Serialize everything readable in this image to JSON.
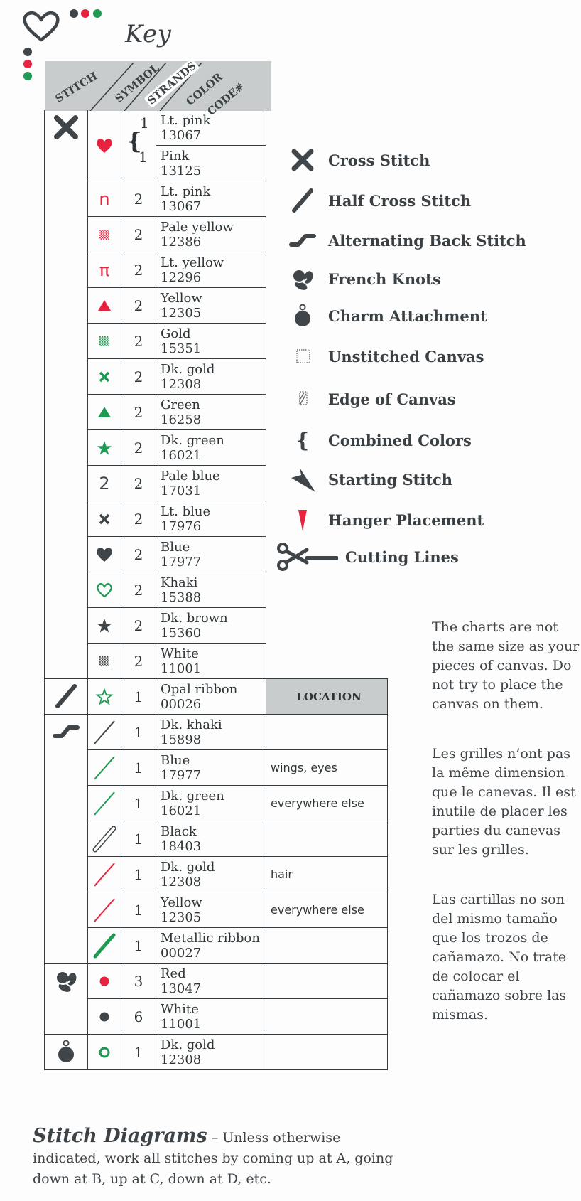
{
  "page": {
    "title": "Key",
    "decor_colors": {
      "dark": "#3f4548",
      "red": "#e8233f",
      "green": "#1e9a52"
    }
  },
  "key_table": {
    "headers": {
      "stitch": "STITCH",
      "symbol": "SYMBOL",
      "strands": "STRANDS",
      "color": "COLOR",
      "code": "CODE#",
      "location": "LOCATION"
    },
    "rows": [
      {
        "stitch": "cross-stitch",
        "symbol": "heart-filled",
        "symbol_color": "#e8233f",
        "strands": "1",
        "color": "Lt. pink",
        "code": "13067",
        "combined": true
      },
      {
        "stitch": "",
        "symbol": "",
        "symbol_color": "",
        "strands": "1",
        "color": "Pink",
        "code": "13125",
        "combined": true
      },
      {
        "stitch": "",
        "symbol": "n",
        "symbol_color": "#e8233f",
        "strands": "2",
        "color": "Lt. pink",
        "code": "13067"
      },
      {
        "stitch": "",
        "symbol": "checker",
        "symbol_color": "#e8233f",
        "strands": "2",
        "color": "Pale yellow",
        "code": "12386"
      },
      {
        "stitch": "",
        "symbol": "π",
        "symbol_color": "#e8233f",
        "strands": "2",
        "color": "Lt. yellow",
        "code": "12296"
      },
      {
        "stitch": "",
        "symbol": "triangle",
        "symbol_color": "#e8233f",
        "strands": "2",
        "color": "Yellow",
        "code": "12305"
      },
      {
        "stitch": "",
        "symbol": "checker",
        "symbol_color": "#1e9a52",
        "strands": "2",
        "color": "Gold",
        "code": "15351"
      },
      {
        "stitch": "",
        "symbol": "x",
        "symbol_color": "#1e9a52",
        "strands": "2",
        "color": "Dk. gold",
        "code": "12308"
      },
      {
        "stitch": "",
        "symbol": "triangle",
        "symbol_color": "#1e9a52",
        "strands": "2",
        "color": "Green",
        "code": "16258"
      },
      {
        "stitch": "",
        "symbol": "star",
        "symbol_color": "#1e9a52",
        "strands": "2",
        "color": "Dk. green",
        "code": "16021"
      },
      {
        "stitch": "",
        "symbol": "2",
        "symbol_color": "#3f4548",
        "strands": "2",
        "color": "Pale blue",
        "code": "17031"
      },
      {
        "stitch": "",
        "symbol": "x",
        "symbol_color": "#3f4548",
        "strands": "2",
        "color": "Lt. blue",
        "code": "17976"
      },
      {
        "stitch": "",
        "symbol": "heart-filled",
        "symbol_color": "#3f4548",
        "strands": "2",
        "color": "Blue",
        "code": "17977"
      },
      {
        "stitch": "",
        "symbol": "heart-outline",
        "symbol_color": "#1e9a52",
        "strands": "2",
        "color": "Khaki",
        "code": "15388"
      },
      {
        "stitch": "",
        "symbol": "star",
        "symbol_color": "#3f4548",
        "strands": "2",
        "color": "Dk. brown",
        "code": "15360"
      },
      {
        "stitch": "",
        "symbol": "checker",
        "symbol_color": "#3f4548",
        "strands": "2",
        "color": "White",
        "code": "11001"
      },
      {
        "stitch": "half-cross-stitch",
        "symbol": "star-outline",
        "symbol_color": "#1e9a52",
        "strands": "1",
        "color": "Opal ribbon",
        "code": "00026",
        "location": ""
      },
      {
        "stitch": "alternating-back-stitch",
        "symbol": "line-thin",
        "symbol_color": "#3f4548",
        "strands": "1",
        "color": "Dk. khaki",
        "code": "15898",
        "location": ""
      },
      {
        "stitch": "",
        "symbol": "line-thin",
        "symbol_color": "#1e9a52",
        "strands": "1",
        "color": "Blue",
        "code": "17977",
        "location": "wings, eyes"
      },
      {
        "stitch": "",
        "symbol": "line-thin",
        "symbol_color": "#1e9a52",
        "strands": "1",
        "color": "Dk. green",
        "code": "16021",
        "location": "everywhere else"
      },
      {
        "stitch": "",
        "symbol": "line-outline",
        "symbol_color": "#3f4548",
        "strands": "1",
        "color": "Black",
        "code": "18403",
        "location": ""
      },
      {
        "stitch": "",
        "symbol": "line-thin",
        "symbol_color": "#e8233f",
        "strands": "1",
        "color": "Dk. gold",
        "code": "12308",
        "location": "hair"
      },
      {
        "stitch": "",
        "symbol": "line-thin",
        "symbol_color": "#e8233f",
        "strands": "1",
        "color": "Yellow",
        "code": "12305",
        "location": "everywhere else"
      },
      {
        "stitch": "",
        "symbol": "line-thick",
        "symbol_color": "#1e9a52",
        "strands": "1",
        "color": "Metallic ribbon",
        "code": "00027",
        "location": ""
      },
      {
        "stitch": "french-knots",
        "symbol": "dot",
        "symbol_color": "#e8233f",
        "strands": "3",
        "color": "Red",
        "code": "13047",
        "location": ""
      },
      {
        "stitch": "",
        "symbol": "dot",
        "symbol_color": "#3f4548",
        "strands": "6",
        "color": "White",
        "code": "11001",
        "location": ""
      },
      {
        "stitch": "charm-attachment",
        "symbol": "ring",
        "symbol_color": "#1e9a52",
        "strands": "1",
        "color": "Dk. gold",
        "code": "12308",
        "location": ""
      }
    ]
  },
  "legend": [
    {
      "icon": "cross-stitch",
      "label": "Cross Stitch"
    },
    {
      "icon": "half-cross-stitch",
      "label": "Half Cross Stitch"
    },
    {
      "icon": "alternating-back-stitch",
      "label": "Alternating Back Stitch"
    },
    {
      "icon": "french-knots",
      "label": "French Knots"
    },
    {
      "icon": "charm-attachment",
      "label": "Charm Attachment"
    },
    {
      "icon": "unstitched-canvas",
      "label": "Unstitched Canvas"
    },
    {
      "icon": "edge-of-canvas",
      "label": "Edge of Canvas"
    },
    {
      "icon": "combined-colors",
      "label": "Combined Colors"
    },
    {
      "icon": "starting-stitch",
      "label": "Starting Stitch"
    },
    {
      "icon": "hanger-placement",
      "label": "Hanger Placement"
    },
    {
      "icon": "cutting-lines",
      "label": "Cutting Lines"
    }
  ],
  "notes": {
    "en": "The charts are not the same size as your pieces of canvas. Do not try to place the canvas on them.",
    "fr": "Les grilles n’ont pas la même dimension que le canevas. Il est inutile de placer les parties du canevas sur les grilles.",
    "es": "Las cartillas no son del mismo tamaño que los trozos de cañamazo. No trate de colocar el cañamazo sobre las mismas."
  },
  "stitch_diagrams": {
    "title": "Stitch Diagrams",
    "text": " – Unless otherwise indicated, work all stitches by coming up at A, going down at B, up at C, down at D, etc."
  }
}
